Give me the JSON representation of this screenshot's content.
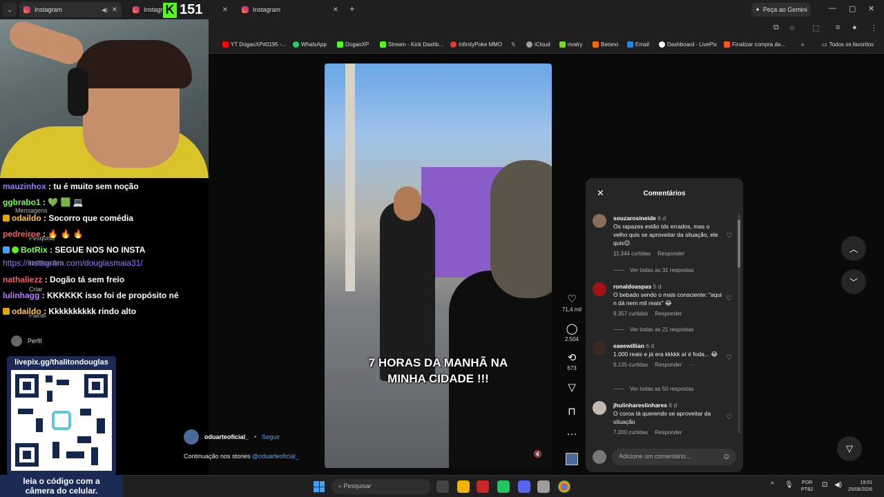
{
  "browser": {
    "tabs": [
      {
        "title": "Instagram"
      },
      {
        "title": "Instagram"
      },
      {
        "title": "Instagram"
      }
    ],
    "gemini_label": "Peça ao Gemini",
    "bookmarks": [
      {
        "label": "YT DogaoXP#0195 -...",
        "color": "#ff0000"
      },
      {
        "label": "WhatsApp",
        "color": "#25d366"
      },
      {
        "label": "DogaoXP",
        "color": "#53fc18"
      },
      {
        "label": "Stream - Kick Dashb...",
        "color": "#53fc18"
      },
      {
        "label": "InfinityPoke MMO",
        "color": "#e53935"
      },
      {
        "label": "",
        "color": "#ffffff"
      },
      {
        "label": "iCloud",
        "color": "#9aa0a6"
      },
      {
        "label": "rivalry",
        "color": "#7cd42a"
      },
      {
        "label": "Betano",
        "color": "#ff6a00"
      },
      {
        "label": "Email",
        "color": "#1e88e5"
      },
      {
        "label": "Dashboard - LivePix",
        "color": "#ffffff"
      },
      {
        "label": "Finalizar compra da...",
        "color": "#ff5722"
      }
    ],
    "all_favorites": "Todos os favoritos"
  },
  "stream": {
    "kick_logo": "K",
    "viewer_count": "151",
    "chat": [
      {
        "user": "mauzinhox",
        "msg": " : tu é muito sem noção",
        "color": "#8f7cff",
        "badge": false
      },
      {
        "user": "ggbrabo1",
        "msg": " : 💚 🟩 💻",
        "color": "#7cff4a",
        "badge": false
      },
      {
        "user": "odaildo",
        "msg": " : Socorro que comédia",
        "color": "#ffc83d",
        "badge": true
      },
      {
        "user": "pedreiroe",
        "msg": " : 🔥 🔥 🔥",
        "color": "#ff5a5a",
        "badge": false
      },
      {
        "user": "BotRix",
        "msg": " : SEGUE NOS NO INSTA",
        "color": "#7cff4a",
        "badge": true
      },
      {
        "user": "",
        "msg": "https://instagram.com/douglasmaia31/",
        "color": "#8f7cff",
        "badge": false
      },
      {
        "user": "nathaliezz",
        "msg": " : Dogão tá sem freio",
        "color": "#ff5a5a",
        "badge": false
      },
      {
        "user": "lulinhagg",
        "msg": " : KKKKKK isso foi de propósito né",
        "color": "#c07cff",
        "badge": false
      },
      {
        "user": "odaildo",
        "msg": " : Kkkkkkkkkk rindo alto",
        "color": "#ffc83d",
        "badge": true
      }
    ],
    "ghost_nav": [
      "Mensagens",
      "Pesquisa",
      "Notificações",
      "Criar",
      "Painel"
    ],
    "livepix_url": "livepix.gg/thalitondouglas",
    "qr_caption_line1": "leia o código com a",
    "qr_caption_line2": "câmera do celular."
  },
  "instagram": {
    "perfil_label": "Perfil",
    "video_caption_line1": "7 HORAS DA MANHÃ NA",
    "video_caption_line2": "MINHA CIDADE !!!",
    "likes": "71,4 mil",
    "comments_count": "2.504",
    "reposts": "673",
    "poster_name": "oduarteoficial_",
    "follow_label": "Seguir",
    "post_caption": "Continuação nos stories ",
    "post_mention": "@oduarteoficial_",
    "comments_panel": {
      "title": "Comentários",
      "items": [
        {
          "user": "souzarosineide",
          "age": "6 d",
          "text": "Os rapazes estão tds errados, mas o velho quis se aproveitar da situação, ele quis😉",
          "likes": "11.344 curtidas",
          "reply": "Responder",
          "replies": "Ver todas as 31 respostas"
        },
        {
          "user": "ronaldoaspas",
          "age": "5 d",
          "text": "O bebado sendo o mais consciente: \"aqui n dá nem mil reais\" 😂",
          "likes": "9.357 curtidas",
          "reply": "Responder",
          "replies": "Ver todas as 21 respostas"
        },
        {
          "user": "eaeewillian",
          "age": "6 d",
          "text": "1.000 reais e já era kkkkk aí é foda... 😂",
          "likes": "9.135 curtidas",
          "reply": "Responder",
          "replies": "Ver todas as 50 respostas"
        },
        {
          "user": "jhulinhareslinhares",
          "age": "6 d",
          "text": "O coroa tá querendo se aproveitar da situação",
          "likes": "7.000 curtidas",
          "reply": "Responder",
          "replies": ""
        }
      ],
      "add_placeholder": "Adicione um comentário..."
    }
  },
  "taskbar": {
    "search_placeholder": "Pesquisar",
    "lang_top": "POR",
    "lang_bottom": "PTB2",
    "time": "19:01",
    "date": "25/08/2026"
  }
}
